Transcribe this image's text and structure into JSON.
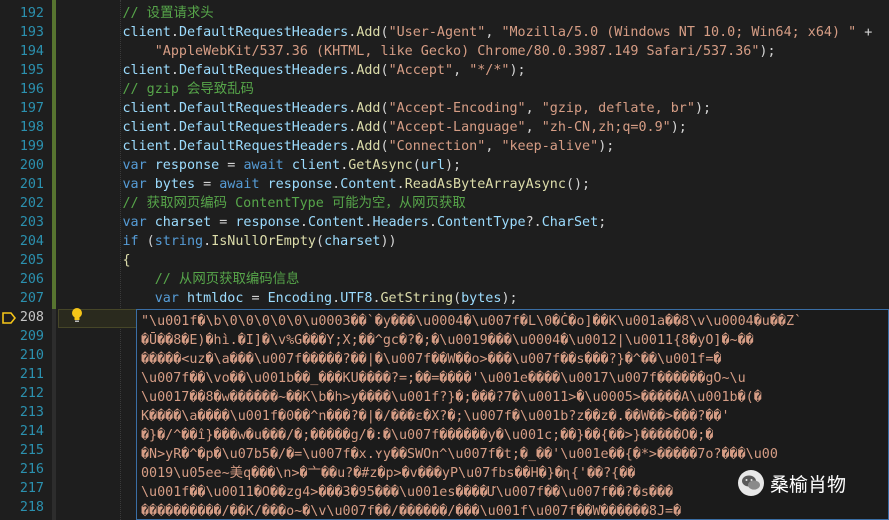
{
  "editor": {
    "line_numbers": [
      "192",
      "193",
      "194",
      "195",
      "196",
      "197",
      "198",
      "199",
      "200",
      "201",
      "202",
      "203",
      "204",
      "205",
      "206",
      "207",
      "208",
      "209",
      "210",
      "211",
      "212",
      "213",
      "214",
      "215",
      "216",
      "217",
      "218"
    ],
    "current_line": "208",
    "code": [
      {
        "tokens": [
          {
            "c": "cmt",
            "t": "// 设置请求头"
          }
        ],
        "indent": "        "
      },
      {
        "tokens": [
          {
            "c": "id",
            "t": "client"
          },
          {
            "c": "plain",
            "t": "."
          },
          {
            "c": "id",
            "t": "DefaultRequestHeaders"
          },
          {
            "c": "plain",
            "t": "."
          },
          {
            "c": "mth",
            "t": "Add"
          },
          {
            "c": "plain",
            "t": "("
          },
          {
            "c": "str",
            "t": "\"User-Agent\""
          },
          {
            "c": "plain",
            "t": ", "
          },
          {
            "c": "str",
            "t": "\"Mozilla/5.0 (Windows NT 10.0; Win64; x64) \""
          },
          {
            "c": "plain",
            "t": " +"
          }
        ],
        "indent": "        "
      },
      {
        "tokens": [
          {
            "c": "str",
            "t": "\"AppleWebKit/537.36 (KHTML, like Gecko) Chrome/80.0.3987.149 Safari/537.36\""
          },
          {
            "c": "plain",
            "t": ");"
          }
        ],
        "indent": "            "
      },
      {
        "tokens": [
          {
            "c": "id",
            "t": "client"
          },
          {
            "c": "plain",
            "t": "."
          },
          {
            "c": "id",
            "t": "DefaultRequestHeaders"
          },
          {
            "c": "plain",
            "t": "."
          },
          {
            "c": "mth",
            "t": "Add"
          },
          {
            "c": "plain",
            "t": "("
          },
          {
            "c": "str",
            "t": "\"Accept\""
          },
          {
            "c": "plain",
            "t": ", "
          },
          {
            "c": "str",
            "t": "\"*/*\""
          },
          {
            "c": "plain",
            "t": ");"
          }
        ],
        "indent": "        "
      },
      {
        "tokens": [
          {
            "c": "cmt",
            "t": "// gzip 会导致乱码"
          }
        ],
        "indent": "        "
      },
      {
        "tokens": [
          {
            "c": "id",
            "t": "client"
          },
          {
            "c": "plain",
            "t": "."
          },
          {
            "c": "id",
            "t": "DefaultRequestHeaders"
          },
          {
            "c": "plain",
            "t": "."
          },
          {
            "c": "mth",
            "t": "Add"
          },
          {
            "c": "plain",
            "t": "("
          },
          {
            "c": "str",
            "t": "\"Accept-Encoding\""
          },
          {
            "c": "plain",
            "t": ", "
          },
          {
            "c": "str",
            "t": "\"gzip, deflate, br\""
          },
          {
            "c": "plain",
            "t": ");"
          }
        ],
        "indent": "        "
      },
      {
        "tokens": [
          {
            "c": "id",
            "t": "client"
          },
          {
            "c": "plain",
            "t": "."
          },
          {
            "c": "id",
            "t": "DefaultRequestHeaders"
          },
          {
            "c": "plain",
            "t": "."
          },
          {
            "c": "mth",
            "t": "Add"
          },
          {
            "c": "plain",
            "t": "("
          },
          {
            "c": "str",
            "t": "\"Accept-Language\""
          },
          {
            "c": "plain",
            "t": ", "
          },
          {
            "c": "str",
            "t": "\"zh-CN,zh;q=0.9\""
          },
          {
            "c": "plain",
            "t": ");"
          }
        ],
        "indent": "        "
      },
      {
        "tokens": [
          {
            "c": "id",
            "t": "client"
          },
          {
            "c": "plain",
            "t": "."
          },
          {
            "c": "id",
            "t": "DefaultRequestHeaders"
          },
          {
            "c": "plain",
            "t": "."
          },
          {
            "c": "mth",
            "t": "Add"
          },
          {
            "c": "plain",
            "t": "("
          },
          {
            "c": "str",
            "t": "\"Connection\""
          },
          {
            "c": "plain",
            "t": ", "
          },
          {
            "c": "str",
            "t": "\"keep-alive\""
          },
          {
            "c": "plain",
            "t": ");"
          }
        ],
        "indent": "        "
      },
      {
        "tokens": [
          {
            "c": "kw",
            "t": "var"
          },
          {
            "c": "plain",
            "t": " "
          },
          {
            "c": "id",
            "t": "response"
          },
          {
            "c": "plain",
            "t": " = "
          },
          {
            "c": "kw",
            "t": "await"
          },
          {
            "c": "plain",
            "t": " "
          },
          {
            "c": "id",
            "t": "client"
          },
          {
            "c": "plain",
            "t": "."
          },
          {
            "c": "mth",
            "t": "GetAsync"
          },
          {
            "c": "plain",
            "t": "("
          },
          {
            "c": "id",
            "t": "url"
          },
          {
            "c": "plain",
            "t": ");"
          }
        ],
        "indent": "        "
      },
      {
        "tokens": [
          {
            "c": "kw",
            "t": "var"
          },
          {
            "c": "plain",
            "t": " "
          },
          {
            "c": "id",
            "t": "bytes"
          },
          {
            "c": "plain",
            "t": " = "
          },
          {
            "c": "kw",
            "t": "await"
          },
          {
            "c": "plain",
            "t": " "
          },
          {
            "c": "id",
            "t": "response"
          },
          {
            "c": "plain",
            "t": "."
          },
          {
            "c": "id",
            "t": "Content"
          },
          {
            "c": "plain",
            "t": "."
          },
          {
            "c": "mth",
            "t": "ReadAsByteArrayAsync"
          },
          {
            "c": "plain",
            "t": "();"
          }
        ],
        "indent": "        "
      },
      {
        "tokens": [
          {
            "c": "cmt",
            "t": "// 获取网页编码 ContentType 可能为空，从网页获取"
          }
        ],
        "indent": "        "
      },
      {
        "tokens": [
          {
            "c": "kw",
            "t": "var"
          },
          {
            "c": "plain",
            "t": " "
          },
          {
            "c": "id",
            "t": "charset"
          },
          {
            "c": "plain",
            "t": " = "
          },
          {
            "c": "id",
            "t": "response"
          },
          {
            "c": "plain",
            "t": "."
          },
          {
            "c": "id",
            "t": "Content"
          },
          {
            "c": "plain",
            "t": "."
          },
          {
            "c": "id",
            "t": "Headers"
          },
          {
            "c": "plain",
            "t": "."
          },
          {
            "c": "id",
            "t": "ContentType"
          },
          {
            "c": "plain",
            "t": "?."
          },
          {
            "c": "id",
            "t": "CharSet"
          },
          {
            "c": "plain",
            "t": ";"
          }
        ],
        "indent": "        "
      },
      {
        "tokens": [
          {
            "c": "kw",
            "t": "if"
          },
          {
            "c": "plain",
            "t": " ("
          },
          {
            "c": "kw",
            "t": "string"
          },
          {
            "c": "plain",
            "t": "."
          },
          {
            "c": "mth",
            "t": "IsNullOrEmpty"
          },
          {
            "c": "plain",
            "t": "("
          },
          {
            "c": "id",
            "t": "charset"
          },
          {
            "c": "plain",
            "t": "))"
          }
        ],
        "indent": "        "
      },
      {
        "tokens": [
          {
            "c": "mth",
            "t": "{"
          }
        ],
        "indent": "        "
      },
      {
        "tokens": [
          {
            "c": "cmt",
            "t": "// 从网页获取编码信息"
          }
        ],
        "indent": "            "
      },
      {
        "tokens": [
          {
            "c": "kw",
            "t": "var"
          },
          {
            "c": "plain",
            "t": " "
          },
          {
            "c": "id",
            "t": "htmldoc"
          },
          {
            "c": "plain",
            "t": " = "
          },
          {
            "c": "id",
            "t": "Encoding"
          },
          {
            "c": "plain",
            "t": "."
          },
          {
            "c": "id",
            "t": "UTF8"
          },
          {
            "c": "plain",
            "t": "."
          },
          {
            "c": "mth",
            "t": "GetString"
          },
          {
            "c": "plain",
            "t": "("
          },
          {
            "c": "id",
            "t": "bytes"
          },
          {
            "c": "plain",
            "t": ");"
          }
        ],
        "indent": "            "
      }
    ],
    "tooltip_lines": [
      "\"\\u001f�\\b\\0\\0\\0\\0\\0\\u0003��`�y���\\u0004�\\u007f�L\\0�Ċ�o]��K\\u001a��8\\v\\u0004�u��Z`",
      "�Ū��8�E)�hì.�I]�\\v%G���Y;X;��^gc�?�;�\\u0019���\\u0004�\\u0012|\\u0011{8�yO]�~��",
      "�����<uz�\\a���\\u007f�����?��|�\\u007f��W��o>���\\u007f��s���?}�^��\\u001f=�",
      "\\u007f��\\vo��\\u001b��_���KU����?=;��=����'\\u001e����\\u0017\\u007f������gO~\\u",
      "\\u0017��8�w������~��K\\b�h>y����\\u001f?}�;���?7�\\u0011>�\\u0005>�����A\\u001b�(�",
      "K����\\a����\\u001f�0��^n���?�|�/���ɛ�X?�;\\u007f�\\u001b?z��z�.��W��>���?��'",
      "�}�/^��î}���w�u���/�;�����g/�:�\\u007f������y�\\u001c;��}��{��>}�����O�;�",
      "�N>yR�^�p�\\u07b5�/�=\\u007f�x.ʏy��SWOn^\\u007f�t;�_��'\\u001e��{�*>�����7o?���\\u00",
      "0019\\u05ee~美q���\\n>�亠��u?�#z�p>�v���yP\\u07fbs��H�}�ɳ{'��?{��",
      "\\u001f��\\u0011�O��zg4>���3�95���\\u001es����Ư\\u007f��\\u007f��?�s���",
      "����������/��K/���o~�\\v\\u007f��/������/���\\u001f\\u007f��W������8J=�"
    ]
  },
  "watermark": {
    "text": "桑榆肖物",
    "icon": "wechat-icon"
  },
  "colors": {
    "background": "#1e1e1e",
    "line_number": "#2b91af",
    "keyword": "#569cd6",
    "string": "#d69d85",
    "comment": "#57a64a",
    "identifier": "#9cdcfe",
    "method": "#dcdcaa",
    "tooltip_border": "#3a6ea5"
  }
}
